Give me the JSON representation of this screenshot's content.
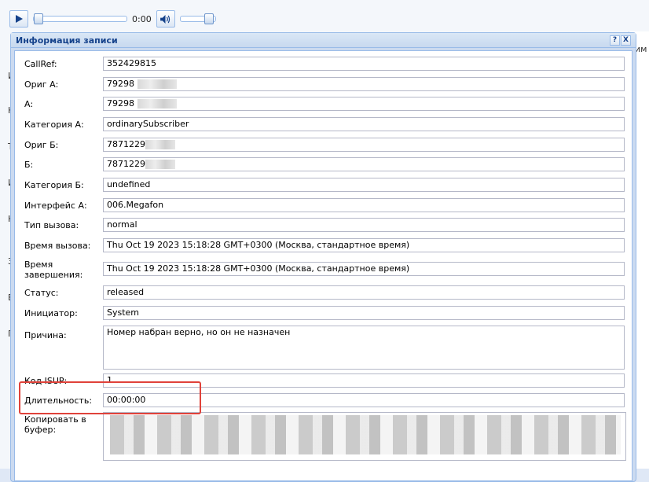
{
  "player": {
    "time": "0:00",
    "play_icon": "play-icon",
    "volume_icon": "volume-icon"
  },
  "background": {
    "side_letters": [
      "И",
      "Н",
      "Т",
      "И",
      "Н",
      "З",
      "В",
      "П"
    ],
    "column_header": "им"
  },
  "window": {
    "title": "Информация записи",
    "tools": [
      "?",
      "X"
    ]
  },
  "fields": [
    {
      "label": "CallRef:",
      "value": "352429815"
    },
    {
      "label": "Ориг А:",
      "value": "79298"
    },
    {
      "label": "А:",
      "value": "79298"
    },
    {
      "label": "Категория А:",
      "value": "ordinarySubscriber"
    },
    {
      "label": "Ориг Б:",
      "value": "7871229"
    },
    {
      "label": "Б:",
      "value": "7871229"
    },
    {
      "label": "Категория Б:",
      "value": "undefined"
    },
    {
      "label": "Интерфейс А:",
      "value": "006.Megafon"
    },
    {
      "label": "Тип вызова:",
      "value": "normal"
    },
    {
      "label": "Время вызова:",
      "value": "Thu Oct 19 2023 15:18:28 GMT+0300 (Москва, стандартное время)"
    },
    {
      "label": "Время завершения:",
      "value": "Thu Oct 19 2023 15:18:28 GMT+0300 (Москва, стандартное время)"
    },
    {
      "label": "Статус:",
      "value": "released"
    },
    {
      "label": "Инициатор:",
      "value": "System"
    },
    {
      "label": "Причина:",
      "value": "Номер набран верно, но он не назначен"
    },
    {
      "label": "Код ISUP:",
      "value": "1"
    },
    {
      "label": "Длительность:",
      "value": "00:00:00"
    },
    {
      "label": "Копировать в буфер:",
      "value": ""
    }
  ],
  "colors": {
    "highlight": "#e0423a",
    "title": "#15428b",
    "frame": "#99bbe8"
  }
}
